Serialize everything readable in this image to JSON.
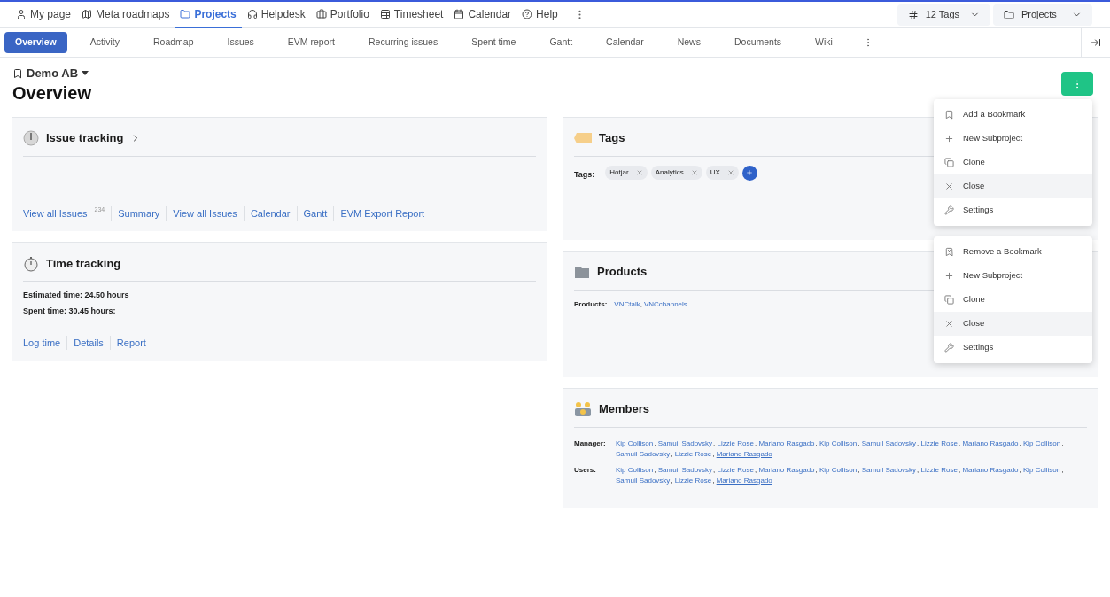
{
  "top_nav": [
    {
      "label": "My page",
      "kind": "user",
      "selected": false
    },
    {
      "label": "Meta roadmaps",
      "kind": "map",
      "selected": false
    },
    {
      "label": "Projects",
      "kind": "folder",
      "selected": true
    },
    {
      "label": "Helpdesk",
      "kind": "headset",
      "selected": false
    },
    {
      "label": "Portfolio",
      "kind": "briefcase",
      "selected": false
    },
    {
      "label": "Timesheet",
      "kind": "sheet",
      "selected": false
    },
    {
      "label": "Calendar",
      "kind": "calendar",
      "selected": false
    },
    {
      "label": "Help",
      "kind": "help",
      "selected": false
    }
  ],
  "tags_dropdown": "12 Tags",
  "projects_dropdown": "Projects",
  "tabs": [
    {
      "label": "Overview",
      "selected": true
    },
    {
      "label": "Activity",
      "selected": false
    },
    {
      "label": "Roadmap",
      "selected": false
    },
    {
      "label": "Issues",
      "selected": false
    },
    {
      "label": "EVM report",
      "selected": false
    },
    {
      "label": "Recurring issues",
      "selected": false
    },
    {
      "label": "Spent time",
      "selected": false
    },
    {
      "label": "Gantt",
      "selected": false
    },
    {
      "label": "Calendar",
      "selected": false
    },
    {
      "label": "News",
      "selected": false
    },
    {
      "label": "Documents",
      "selected": false
    },
    {
      "label": "Wiki",
      "selected": false
    }
  ],
  "project": "Demo AB",
  "title": "Overview",
  "issue_tracking": {
    "title": "Issue tracking",
    "links": [
      {
        "label": "View all Issues",
        "count": "234"
      },
      {
        "label": "Summary"
      },
      {
        "label": "View all Issues"
      },
      {
        "label": "Calendar"
      },
      {
        "label": "Gantt"
      },
      {
        "label": "EVM Export Report"
      }
    ]
  },
  "time_tracking": {
    "title": "Time tracking",
    "lines": [
      "Estimated time: 24.50 hours",
      "Spent time: 30.45 hours:"
    ],
    "links": [
      "Log time",
      "Details",
      "Report"
    ]
  },
  "tags": {
    "title": "Tags",
    "label": "Tags:",
    "items": [
      "Hotjar",
      "Analytics",
      "UX"
    ]
  },
  "products": {
    "title": "Products",
    "label": "Products:",
    "separator": ",",
    "items": [
      "VNCtalk",
      "VNCchannels"
    ]
  },
  "members": {
    "title": "Members",
    "groups": [
      {
        "label": "Manager:",
        "separator": ",",
        "names": [
          {
            "name": "Kip Collison",
            "hovered": false
          },
          {
            "name": "Samuil Sadovsky",
            "hovered": false
          },
          {
            "name": "Lizzie Rose",
            "hovered": false
          },
          {
            "name": "Mariano Rasgado",
            "hovered": false
          },
          {
            "name": "Kip Collison",
            "hovered": false
          },
          {
            "name": "Samuil Sadovsky",
            "hovered": false
          },
          {
            "name": "Lizzie Rose",
            "hovered": false
          },
          {
            "name": "Mariano Rasgado",
            "hovered": false
          },
          {
            "name": "Kip Collison",
            "hovered": false
          },
          {
            "name": "Samuil Sadovsky",
            "hovered": false
          },
          {
            "name": "Lizzie Rose",
            "hovered": false
          },
          {
            "name": "Mariano Rasgado",
            "hovered": true
          }
        ]
      },
      {
        "label": "Users:",
        "separator": ",",
        "names": [
          {
            "name": "Kip Collison",
            "hovered": false
          },
          {
            "name": "Samuil Sadovsky",
            "hovered": false
          },
          {
            "name": "Lizzie Rose",
            "hovered": false
          },
          {
            "name": "Mariano Rasgado",
            "hovered": false
          },
          {
            "name": "Kip Collison",
            "hovered": false
          },
          {
            "name": "Samuil Sadovsky",
            "hovered": false
          },
          {
            "name": "Lizzie Rose",
            "hovered": false
          },
          {
            "name": "Mariano Rasgado",
            "hovered": false
          },
          {
            "name": "Kip Collison",
            "hovered": false
          },
          {
            "name": "Samuil Sadovsky",
            "hovered": false
          },
          {
            "name": "Lizzie Rose",
            "hovered": false
          },
          {
            "name": "Mariano Rasgado",
            "hovered": true
          }
        ]
      }
    ]
  },
  "menus": [
    [
      {
        "label": "Add a Bookmark",
        "kind": "bookmark",
        "highlighted": false
      },
      {
        "label": "New Subproject",
        "kind": "plus",
        "highlighted": false
      },
      {
        "label": "Clone",
        "kind": "clone",
        "highlighted": false
      },
      {
        "label": "Close",
        "kind": "close",
        "highlighted": true
      },
      {
        "label": "Settings",
        "kind": "settings",
        "highlighted": false
      }
    ],
    [
      {
        "label": "Remove a Bookmark",
        "kind": "bookmark-off",
        "highlighted": false
      },
      {
        "label": "New Subproject",
        "kind": "plus",
        "highlighted": false
      },
      {
        "label": "Clone",
        "kind": "clone",
        "highlighted": false
      },
      {
        "label": "Close",
        "kind": "close",
        "highlighted": true
      },
      {
        "label": "Settings",
        "kind": "settings",
        "highlighted": false
      }
    ]
  ]
}
